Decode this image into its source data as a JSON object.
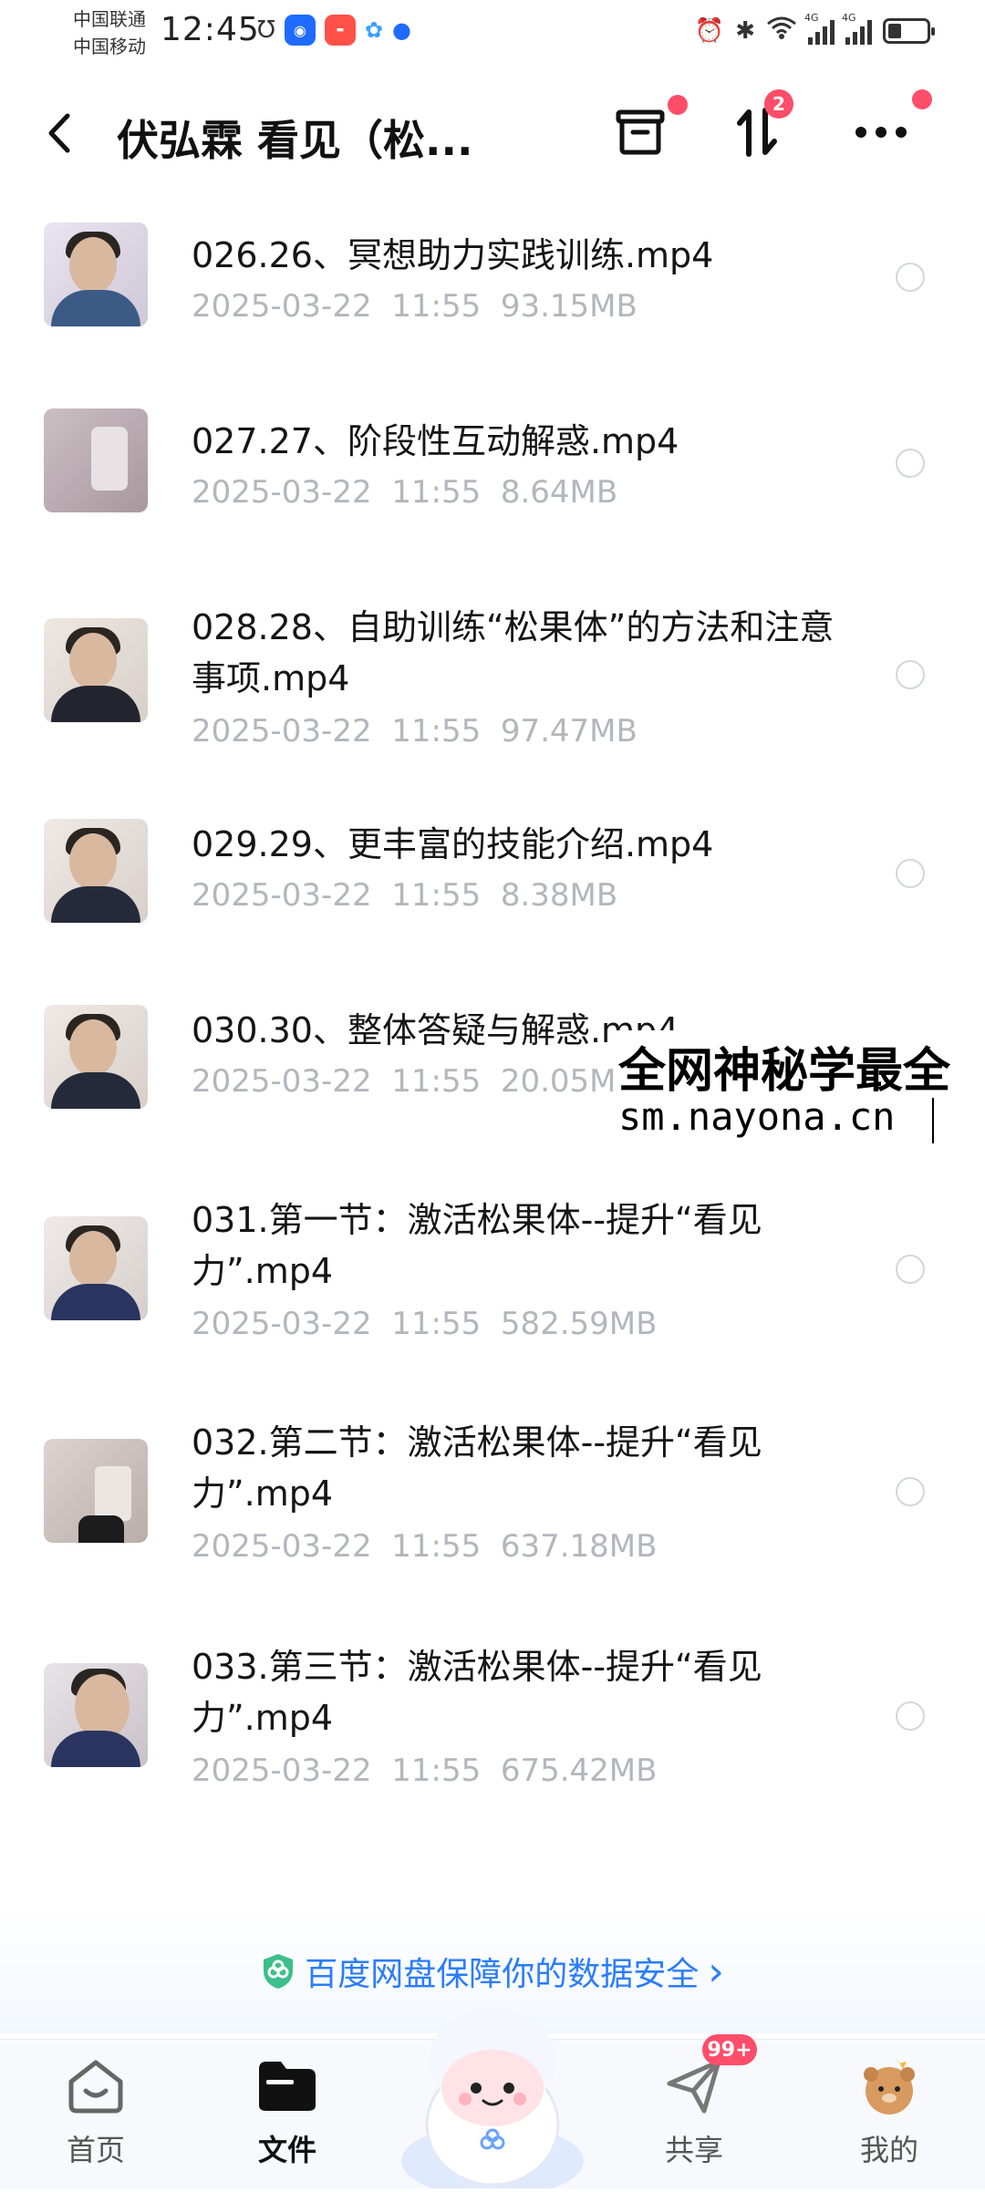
{
  "status_bar": {
    "carrier_1": "中国联通",
    "carrier_2": "中国移动",
    "time": "12:45",
    "signal_1": "4G",
    "signal_2": "4G"
  },
  "header": {
    "title": "伏弘霖 看见（松...",
    "transfer_badge": "2"
  },
  "files": [
    {
      "name": "026.26、冥想助力实践训练.mp4",
      "date": "2025-03-22",
      "time": "11:55",
      "size": "93.15MB"
    },
    {
      "name": "027.27、阶段性互动解惑.mp4",
      "date": "2025-03-22",
      "time": "11:55",
      "size": "8.64MB"
    },
    {
      "name": "028.28、自助训练“松果体”的方法和注意事项.mp4",
      "date": "2025-03-22",
      "time": "11:55",
      "size": "97.47MB"
    },
    {
      "name": "029.29、更丰富的技能介绍.mp4",
      "date": "2025-03-22",
      "time": "11:55",
      "size": "8.38MB"
    },
    {
      "name": "030.30、整体答疑与解惑.mp4",
      "date": "2025-03-22",
      "time": "11:55",
      "size": "20.05MB"
    },
    {
      "name": "031.第一节：激活松果体--提升“看见力”.mp4",
      "date": "2025-03-22",
      "time": "11:55",
      "size": "582.59MB"
    },
    {
      "name": "032.第二节：激活松果体--提升“看见力”.mp4",
      "date": "2025-03-22",
      "time": "11:55",
      "size": "637.18MB"
    },
    {
      "name": "033.第三节：激活松果体--提升“看见力”.mp4",
      "date": "2025-03-22",
      "time": "11:55",
      "size": "675.42MB"
    }
  ],
  "watermark": {
    "line1": "全网神秘学最全",
    "line2": "sm.nayona.cn"
  },
  "banner": {
    "text": "百度网盘保障你的数据安全",
    "chevron": "›"
  },
  "bottom_nav": {
    "home": "首页",
    "files": "文件",
    "share": "共享",
    "share_badge": "99+",
    "mine": "我的"
  },
  "colors": {
    "accent": "#2b7cff",
    "badge": "#ff4d6a",
    "meta_text": "#b3b6bc"
  }
}
